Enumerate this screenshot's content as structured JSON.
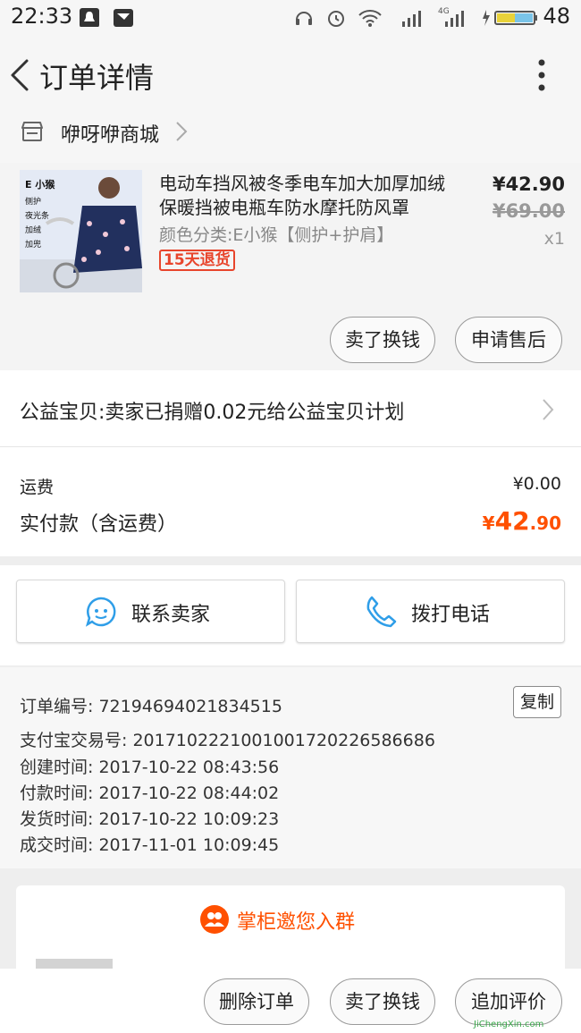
{
  "status_bar": {
    "time": "22:33",
    "network_label": "4G",
    "battery_level": "48"
  },
  "header": {
    "title": "订单详情",
    "back_icon": "chevron-left-icon",
    "more_icon": "more-vertical-icon"
  },
  "shop": {
    "name": "咿呀咿商城",
    "icon": "store-icon"
  },
  "product": {
    "title": "电动车挡风被冬季电车加大加厚加绒保暖挡被电瓶车防水摩托防风罩",
    "sku": "颜色分类:E小猴【侧护+护肩】",
    "tag": "15天退货",
    "price": "¥42.90",
    "original_price": "¥69.00",
    "quantity": "x1",
    "image_labels": {
      "name": "E 小猴",
      "features": [
        "侧护",
        "夜光条",
        "加绒",
        "加兜"
      ]
    },
    "actions": [
      "卖了换钱",
      "申请售后"
    ]
  },
  "charity": {
    "text": "公益宝贝:卖家已捐赠0.02元给公益宝贝计划"
  },
  "fees": {
    "shipping_label": "运费",
    "shipping_value": "¥0.00",
    "paid_label": "实付款（含运费）",
    "paid_symbol": "¥",
    "paid_integer": "42",
    "paid_decimal": ".90"
  },
  "contact": {
    "seller_label": "联系卖家",
    "phone_label": "拨打电话",
    "accent_color": "#2f9ee8"
  },
  "order_info": {
    "lines": [
      "订单编号: 72194694021834515",
      "支付宝交易号: 2017102221001001720226586686",
      "创建时间: 2017-10-22 08:43:56",
      "付款时间: 2017-10-22 08:44:02",
      "发货时间: 2017-10-22 10:09:23",
      "成交时间: 2017-11-01 10:09:45"
    ],
    "copy_label": "复制"
  },
  "group": {
    "text": "掌柜邀您入群",
    "icon": "group-icon"
  },
  "bottom_bar": {
    "actions": [
      "删除订单",
      "卖了换钱",
      "追加评价"
    ]
  },
  "watermark": "JiChengXin.com",
  "colors": {
    "price_orange": "#ff5000",
    "tag_red": "#e8452c"
  }
}
